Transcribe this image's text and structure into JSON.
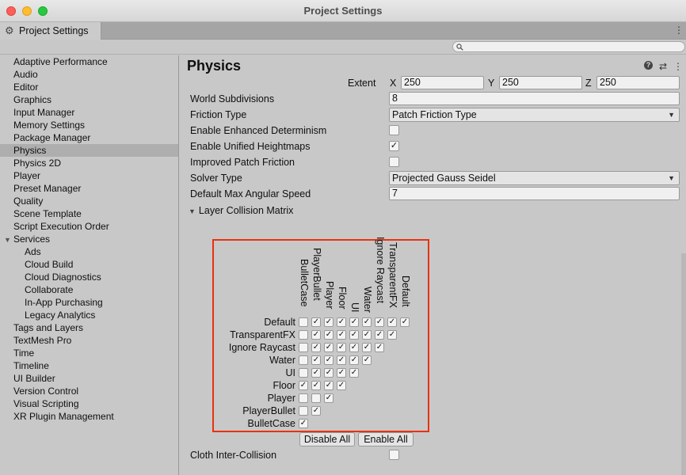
{
  "window": {
    "title": "Project Settings"
  },
  "tab": {
    "label": "Project Settings",
    "icon": "gear-icon",
    "menu": "⋮"
  },
  "search": {
    "placeholder": ""
  },
  "sidebar": {
    "items": [
      {
        "label": "Adaptive Performance",
        "type": "item"
      },
      {
        "label": "Audio",
        "type": "item"
      },
      {
        "label": "Editor",
        "type": "item"
      },
      {
        "label": "Graphics",
        "type": "item"
      },
      {
        "label": "Input Manager",
        "type": "item"
      },
      {
        "label": "Memory Settings",
        "type": "item"
      },
      {
        "label": "Package Manager",
        "type": "item"
      },
      {
        "label": "Physics",
        "type": "item",
        "selected": true
      },
      {
        "label": "Physics 2D",
        "type": "item"
      },
      {
        "label": "Player",
        "type": "item"
      },
      {
        "label": "Preset Manager",
        "type": "item"
      },
      {
        "label": "Quality",
        "type": "item"
      },
      {
        "label": "Scene Template",
        "type": "item"
      },
      {
        "label": "Script Execution Order",
        "type": "item"
      },
      {
        "label": "Services",
        "type": "group"
      },
      {
        "label": "Ads",
        "type": "sub"
      },
      {
        "label": "Cloud Build",
        "type": "sub"
      },
      {
        "label": "Cloud Diagnostics",
        "type": "sub"
      },
      {
        "label": "Collaborate",
        "type": "sub"
      },
      {
        "label": "In-App Purchasing",
        "type": "sub"
      },
      {
        "label": "Legacy Analytics",
        "type": "sub"
      },
      {
        "label": "Tags and Layers",
        "type": "item"
      },
      {
        "label": "TextMesh Pro",
        "type": "item"
      },
      {
        "label": "Time",
        "type": "item"
      },
      {
        "label": "Timeline",
        "type": "item"
      },
      {
        "label": "UI Builder",
        "type": "item"
      },
      {
        "label": "Version Control",
        "type": "item"
      },
      {
        "label": "Visual Scripting",
        "type": "item"
      },
      {
        "label": "XR Plugin Management",
        "type": "item"
      }
    ]
  },
  "physics": {
    "title": "Physics",
    "extent": {
      "label": "Extent",
      "x_label": "X",
      "x": "250",
      "y_label": "Y",
      "y": "250",
      "z_label": "Z",
      "z": "250"
    },
    "world_subdivisions": {
      "label": "World Subdivisions",
      "value": "8"
    },
    "friction_type": {
      "label": "Friction Type",
      "value": "Patch Friction Type"
    },
    "enhanced_determinism": {
      "label": "Enable Enhanced Determinism",
      "checked": false
    },
    "unified_heightmaps": {
      "label": "Enable Unified Heightmaps",
      "checked": true
    },
    "improved_patch_friction": {
      "label": "Improved Patch Friction",
      "checked": false
    },
    "solver_type": {
      "label": "Solver Type",
      "value": "Projected Gauss Seidel"
    },
    "max_angular_speed": {
      "label": "Default Max Angular Speed",
      "value": "7"
    },
    "layer_matrix": {
      "label": "Layer Collision Matrix",
      "rows": [
        "Default",
        "TransparentFX",
        "Ignore Raycast",
        "Water",
        "UI",
        "Floor",
        "Player",
        "PlayerBullet",
        "BulletCase"
      ],
      "columns": [
        "BulletCase",
        "PlayerBullet",
        "Player",
        "Floor",
        "UI",
        "Water",
        "Ignore Raycast",
        "TransparentFX",
        "Default"
      ],
      "cells": [
        [
          false,
          true,
          true,
          true,
          true,
          true,
          true,
          true,
          true
        ],
        [
          false,
          true,
          true,
          true,
          true,
          true,
          true,
          true
        ],
        [
          false,
          true,
          true,
          true,
          true,
          true,
          true
        ],
        [
          false,
          true,
          true,
          true,
          true,
          true
        ],
        [
          false,
          true,
          true,
          true,
          true
        ],
        [
          true,
          true,
          true,
          true
        ],
        [
          false,
          false,
          true
        ],
        [
          false,
          true
        ],
        [
          true
        ]
      ],
      "disable_all": "Disable All",
      "enable_all": "Enable All"
    },
    "cloth_inter_collision": {
      "label": "Cloth Inter-Collision",
      "checked": false
    }
  }
}
